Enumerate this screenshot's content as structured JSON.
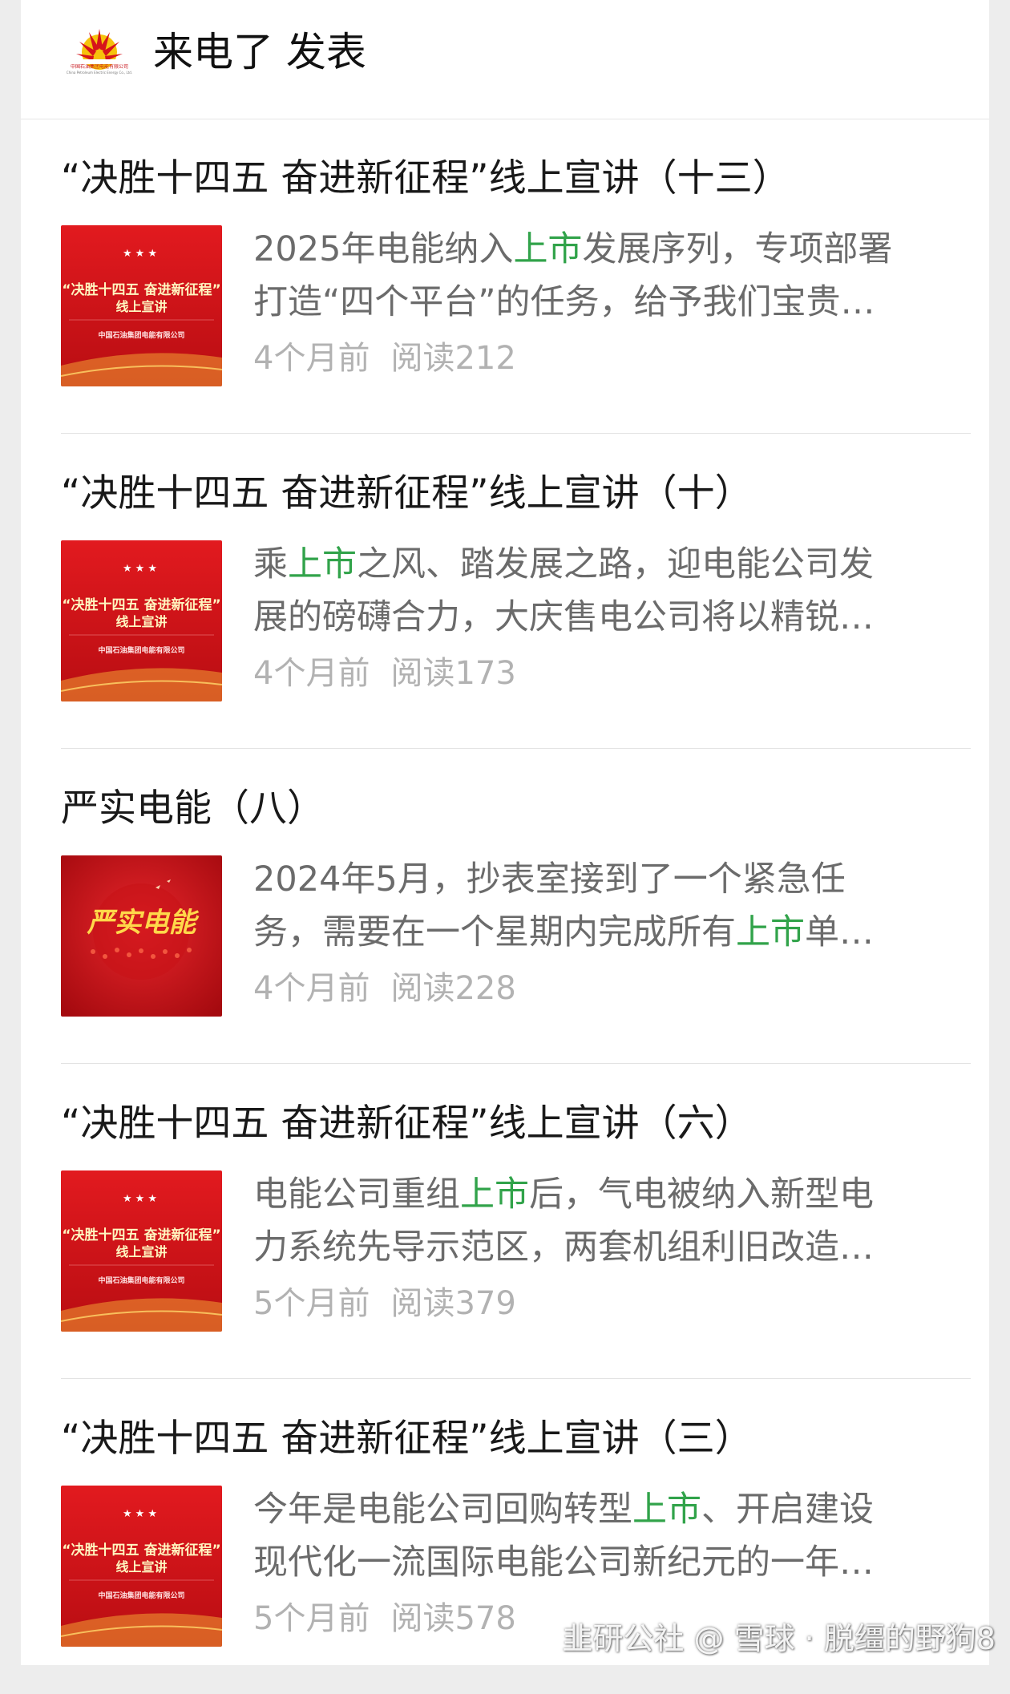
{
  "account": {
    "title": "来电了 发表",
    "logo_caption": "中国石油集团电能有限公司",
    "logo_caption_en": "China Petroleum Electric Energy Co., Ltd."
  },
  "thumb_banner": {
    "title_line1": "“决胜十四五 奋进新征程”",
    "title_line2": "线上宣讲",
    "org": "中国石油集团电能有限公司",
    "script_title": "严实电能"
  },
  "articles": [
    {
      "title": "“决胜十四五 奋进新征程”线上宣讲（十三）",
      "summary_line1_pre": "2025年电能纳入",
      "summary_line1_hl": "上市",
      "summary_line1_post": "发展序列，专项部署",
      "summary_line2_pre": "打造“四个平台”的任务，给予我们宝贵…",
      "summary_line2_hl": "",
      "summary_line2_post": "",
      "time": "4个月前",
      "reads": "阅读212",
      "thumb": "banner"
    },
    {
      "title": "“决胜十四五 奋进新征程”线上宣讲（十）",
      "summary_line1_pre": "乘",
      "summary_line1_hl": "上市",
      "summary_line1_post": "之风、踏发展之路，迎电能公司发",
      "summary_line2_pre": "展的磅礴合力，大庆售电公司将以精锐…",
      "summary_line2_hl": "",
      "summary_line2_post": "",
      "time": "4个月前",
      "reads": "阅读173",
      "thumb": "banner"
    },
    {
      "title": "严实电能（八）",
      "summary_line1_pre": "2024年5月，抄表室接到了一个紧急任",
      "summary_line1_hl": "",
      "summary_line1_post": "",
      "summary_line2_pre": "务，需要在一个星期内完成所有",
      "summary_line2_hl": "上市",
      "summary_line2_post": "单…",
      "time": "4个月前",
      "reads": "阅读228",
      "thumb": "script"
    },
    {
      "title": "“决胜十四五 奋进新征程”线上宣讲（六）",
      "summary_line1_pre": "电能公司重组",
      "summary_line1_hl": "上市",
      "summary_line1_post": "后，气电被纳入新型电",
      "summary_line2_pre": "力系统先导示范区，两套机组利旧改造…",
      "summary_line2_hl": "",
      "summary_line2_post": "",
      "time": "5个月前",
      "reads": "阅读379",
      "thumb": "banner"
    },
    {
      "title": "“决胜十四五 奋进新征程”线上宣讲（三）",
      "summary_line1_pre": "今年是电能公司回购转型",
      "summary_line1_hl": "上市",
      "summary_line1_post": "、开启建设",
      "summary_line2_pre": "现代化一流国际电能公司新纪元的一年…",
      "summary_line2_hl": "",
      "summary_line2_post": "",
      "time": "5个月前",
      "reads": "阅读578",
      "thumb": "banner"
    }
  ],
  "watermark": "韭研公社 @ 雪球 · 脱缰的野狗8",
  "colors": {
    "highlight": "#31a34a",
    "thumb_red": "#d9161c",
    "meta_gray": "#b2b2b2"
  }
}
